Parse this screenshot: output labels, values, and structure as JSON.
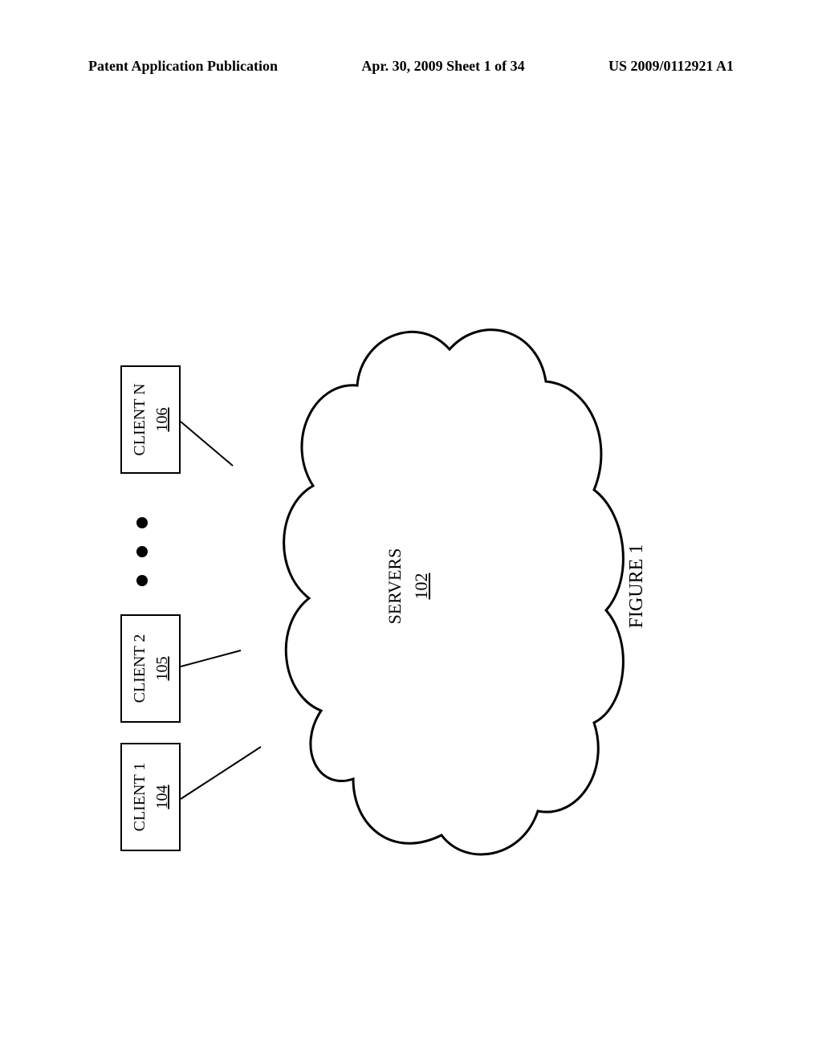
{
  "header": {
    "left": "Patent Application Publication",
    "center": "Apr. 30, 2009  Sheet 1 of 34",
    "right": "US 2009/0112921 A1"
  },
  "clients": {
    "c1_label": "CLIENT 1",
    "c1_ref": "104",
    "c2_label": "CLIENT 2",
    "c2_ref": "105",
    "cn_label": "CLIENT N",
    "cn_ref": "106"
  },
  "cloud": {
    "label": "SERVERS",
    "ref": "102"
  },
  "figure_caption": "FIGURE 1"
}
